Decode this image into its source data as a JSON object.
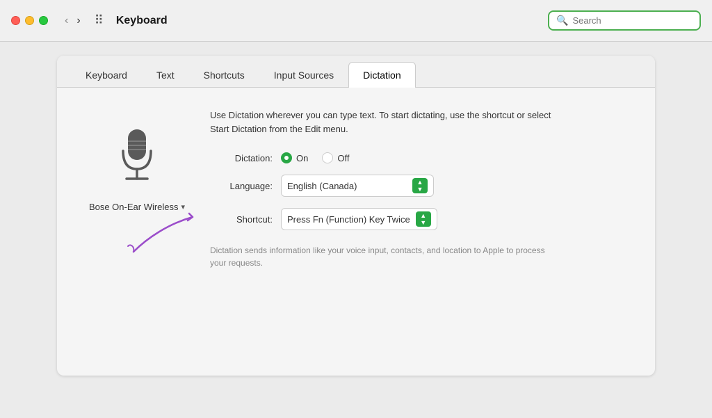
{
  "titlebar": {
    "title": "Keyboard",
    "search_placeholder": "Search"
  },
  "tabs": [
    {
      "id": "keyboard",
      "label": "Keyboard",
      "active": false
    },
    {
      "id": "text",
      "label": "Text",
      "active": false
    },
    {
      "id": "shortcuts",
      "label": "Shortcuts",
      "active": false
    },
    {
      "id": "input-sources",
      "label": "Input Sources",
      "active": false
    },
    {
      "id": "dictation",
      "label": "Dictation",
      "active": true
    }
  ],
  "content": {
    "description": "Use Dictation wherever you can type text. To start dictating, use the shortcut or select Start Dictation from the Edit menu.",
    "dictation_label": "Dictation:",
    "on_label": "On",
    "off_label": "Off",
    "language_label": "Language:",
    "language_value": "English (Canada)",
    "shortcut_label": "Shortcut:",
    "shortcut_value": "Press Fn (Function) Key Twice",
    "footer": "Dictation sends information like your voice input, contacts, and location to Apple to process your requests.",
    "mic_device": "Bose On-Ear Wireless",
    "mic_chevron": "▾"
  }
}
